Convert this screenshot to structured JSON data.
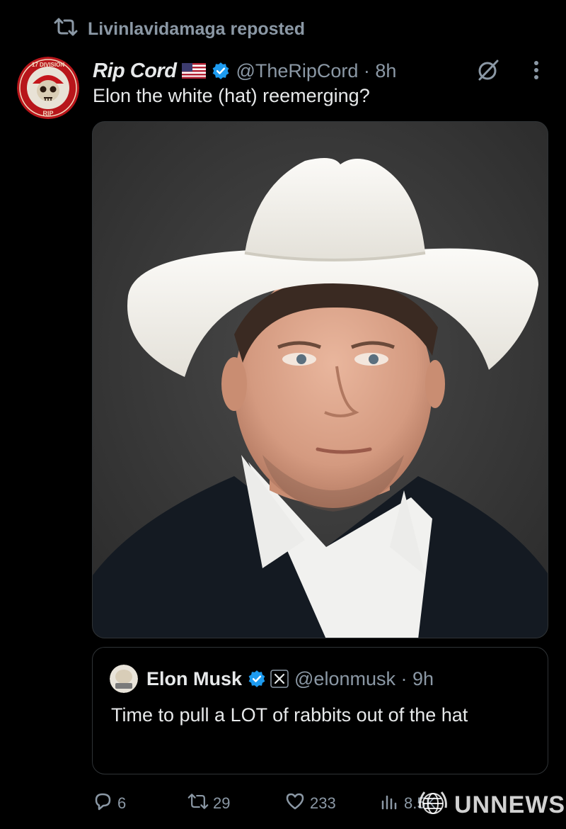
{
  "repost": {
    "icon": "repost-icon",
    "label": "Livinlavidamaga reposted"
  },
  "post": {
    "avatar": {
      "icon": "17-division-rip-badge",
      "ring_text": "17 DIVISION",
      "bottom_text": "RIP"
    },
    "display_name": "Rip Cord",
    "flag": "us-flag-icon",
    "verified": "verified-badge-icon",
    "handle_time": "@TheRipCord · 8h",
    "text": "Elon the white (hat) reemerging?",
    "media": {
      "description_icon": "portrait-photo",
      "subject": "man-in-white-cowboy-hat"
    },
    "top_icons": [
      "grok-icon",
      "more-icon"
    ]
  },
  "quote": {
    "display_name": "Elon Musk",
    "verified": "verified-badge-icon",
    "affiliate": "x-logo-badge",
    "handle_time": "@elonmusk · 9h",
    "text": "Time to pull a LOT of rabbits out of the hat"
  },
  "actions": {
    "reply_count": "6",
    "repost_count": "29",
    "like_count": "233",
    "views_count": "8.5K"
  },
  "watermark": {
    "text": "UNNEWS"
  },
  "colors": {
    "background": "#000000",
    "text": "#e7e9ea",
    "secondary": "#8b98a5",
    "verified": "#1d9bf0",
    "border": "#2f3336"
  }
}
